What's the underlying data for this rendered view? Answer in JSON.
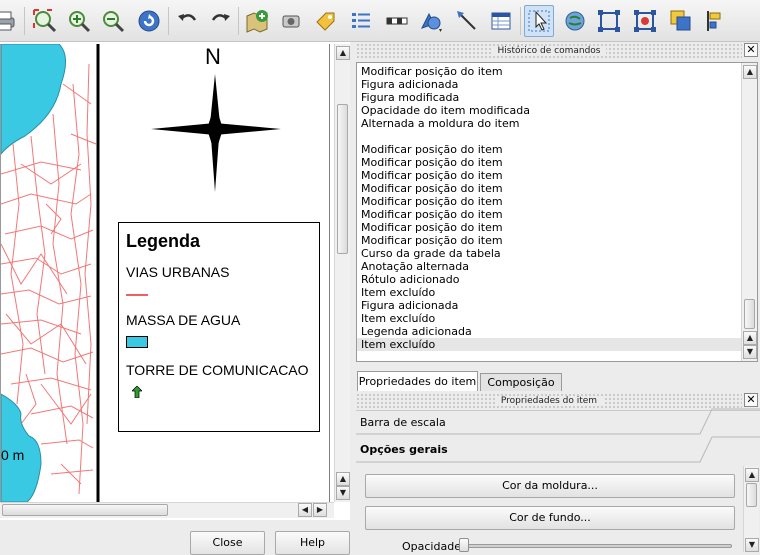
{
  "toolbar": {
    "icons": [
      "print-icon",
      "zoom-full-icon",
      "zoom-in-icon",
      "zoom-out-icon",
      "refresh-icon",
      "undo-icon",
      "redo-icon",
      "add-map-icon",
      "add-image-icon",
      "add-label-icon",
      "add-legend-icon",
      "add-scalebar-icon",
      "add-shape-icon",
      "add-arrow-icon",
      "add-table-icon",
      "select-move-item-icon",
      "move-content-icon",
      "group-icon",
      "ungroup-icon",
      "raise-item-icon",
      "align-icon"
    ]
  },
  "composer": {
    "north_label": "N",
    "scale_fragment": "0 m",
    "legend": {
      "title": "Legenda",
      "items": [
        "VIAS URBANAS",
        "MASSA DE AGUA",
        "TORRE DE COMUNICACAO"
      ]
    },
    "colors": {
      "water": "#3ac9e3",
      "roads": "#f06060",
      "arrow_icon": "#2e9e2e"
    }
  },
  "bottom_buttons": {
    "close": "Close",
    "help": "Help"
  },
  "history_panel": {
    "title": "Histórico de comandos",
    "entries": [
      "Modificar posição do item",
      "Figura adicionada",
      "Figura modificada",
      "Opacidade do item modificada",
      "Alternada a moldura do item",
      "",
      "Modificar posição do item",
      "Modificar posição do item",
      "Modificar posição do item",
      "Modificar posição do item",
      "Modificar posição do item",
      "Modificar posição do item",
      "Modificar posição do item",
      "Modificar posição do item",
      "Curso da grade da tabela",
      "Anotação alternada",
      "Rótulo adicionado",
      "Item excluído",
      "Figura adicionada",
      "Item excluído",
      "Legenda adicionada",
      "Item excluído"
    ]
  },
  "tabs": {
    "item_properties": "Propriedades do item",
    "composition": "Composição"
  },
  "properties_panel": {
    "title": "Propriedades do item",
    "item_type": "Barra de escala",
    "section": "Opções gerais",
    "frame_color_button": "Cor da moldura...",
    "background_color_button": "Cor de fundo...",
    "opacity_label": "Opacidade"
  }
}
